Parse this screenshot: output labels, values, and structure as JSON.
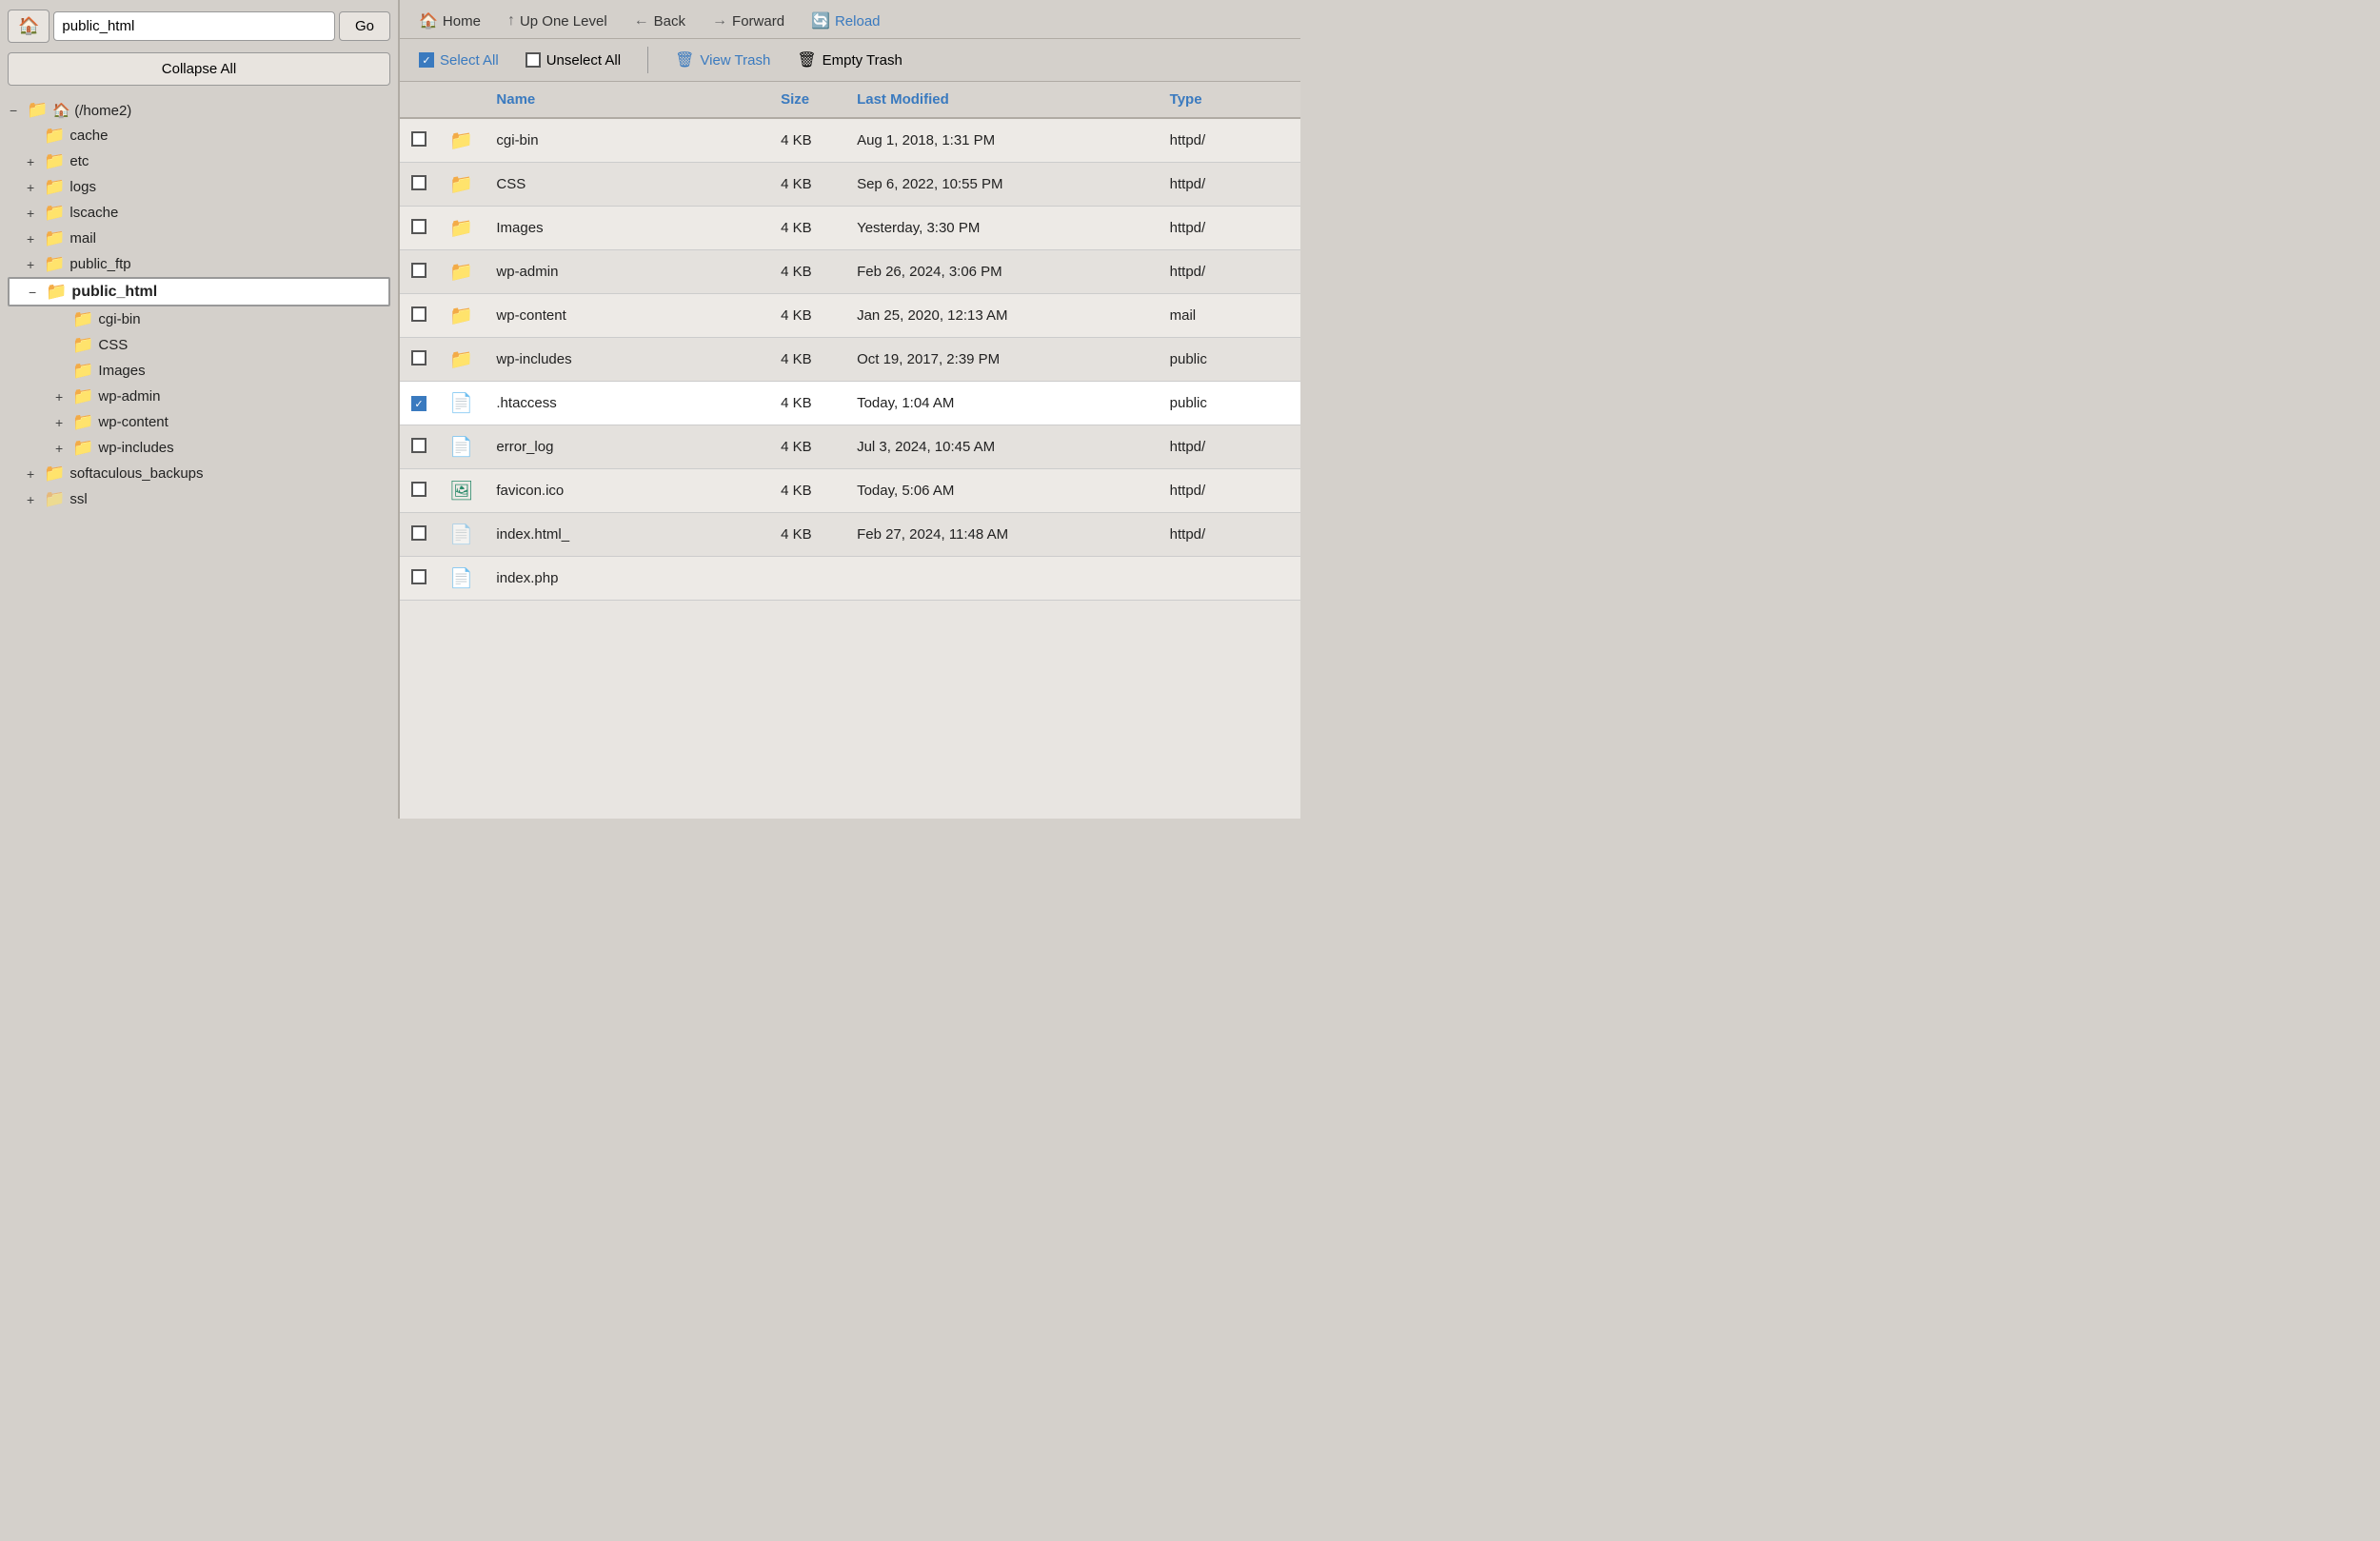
{
  "sidebar": {
    "path_value": "public_html",
    "go_label": "Go",
    "collapse_all_label": "Collapse All",
    "home_icon": "🏠",
    "tree": [
      {
        "id": "home2",
        "level": 0,
        "toggle": "−",
        "icon": "gold",
        "label": "(/home2)",
        "home": true
      },
      {
        "id": "cache",
        "level": 1,
        "toggle": "",
        "icon": "gold",
        "label": "cache"
      },
      {
        "id": "etc",
        "level": 1,
        "toggle": "+",
        "icon": "gold",
        "label": "etc"
      },
      {
        "id": "logs",
        "level": 1,
        "toggle": "+",
        "icon": "gold",
        "label": "logs"
      },
      {
        "id": "lscache",
        "level": 1,
        "toggle": "+",
        "icon": "gold",
        "label": "lscache"
      },
      {
        "id": "mail",
        "level": 1,
        "toggle": "+",
        "icon": "gold",
        "label": "mail"
      },
      {
        "id": "public_ftp",
        "level": 1,
        "toggle": "+",
        "icon": "gold",
        "label": "public_ftp"
      },
      {
        "id": "public_html",
        "level": 1,
        "toggle": "−",
        "icon": "gold",
        "label": "public_html",
        "selected": true
      },
      {
        "id": "cgi-bin-sub",
        "level": 2,
        "toggle": "",
        "icon": "gold",
        "label": "cgi-bin"
      },
      {
        "id": "css-sub",
        "level": 2,
        "toggle": "",
        "icon": "gold",
        "label": "CSS"
      },
      {
        "id": "images-sub",
        "level": 2,
        "toggle": "",
        "icon": "gold",
        "label": "Images"
      },
      {
        "id": "wp-admin-sub",
        "level": 2,
        "toggle": "+",
        "icon": "gold",
        "label": "wp-admin"
      },
      {
        "id": "wp-content-sub",
        "level": 2,
        "toggle": "+",
        "icon": "gold",
        "label": "wp-content"
      },
      {
        "id": "wp-includes-sub",
        "level": 2,
        "toggle": "+",
        "icon": "gold",
        "label": "wp-includes"
      },
      {
        "id": "softaculous",
        "level": 1,
        "toggle": "+",
        "icon": "gold",
        "label": "softaculous_backups"
      },
      {
        "id": "ssl",
        "level": 1,
        "toggle": "+",
        "icon": "light",
        "label": "ssl"
      }
    ]
  },
  "toolbar": {
    "home_label": "Home",
    "up_label": "Up One Level",
    "back_label": "Back",
    "forward_label": "Forward",
    "reload_label": "Reload"
  },
  "actions": {
    "select_all_label": "Select All",
    "unselect_all_label": "Unselect All",
    "view_trash_label": "View Trash",
    "empty_trash_label": "Empty Trash"
  },
  "table": {
    "columns": [
      "Name",
      "Size",
      "Last Modified",
      "Type"
    ],
    "rows": [
      {
        "id": 1,
        "name": "cgi-bin",
        "size": "4 KB",
        "modified": "Aug 1, 2018, 1:31 PM",
        "type": "httpd/",
        "icon": "folder",
        "selected": false
      },
      {
        "id": 2,
        "name": "CSS",
        "size": "4 KB",
        "modified": "Sep 6, 2022, 10:55 PM",
        "type": "httpd/",
        "icon": "folder",
        "selected": false
      },
      {
        "id": 3,
        "name": "Images",
        "size": "4 KB",
        "modified": "Yesterday, 3:30 PM",
        "type": "httpd/",
        "icon": "folder",
        "selected": false
      },
      {
        "id": 4,
        "name": "wp-admin",
        "size": "4 KB",
        "modified": "Feb 26, 2024, 3:06 PM",
        "type": "httpd/",
        "icon": "folder",
        "selected": false
      },
      {
        "id": 5,
        "name": "wp-content",
        "size": "4 KB",
        "modified": "Jan 25, 2020, 12:13 AM",
        "type": "mail",
        "icon": "folder",
        "selected": false
      },
      {
        "id": 6,
        "name": "wp-includes",
        "size": "4 KB",
        "modified": "Oct 19, 2017, 2:39 PM",
        "type": "public",
        "icon": "folder",
        "selected": false
      },
      {
        "id": 7,
        "name": ".htaccess",
        "size": "4 KB",
        "modified": "Today, 1:04 AM",
        "type": "public",
        "icon": "doc",
        "selected": true
      },
      {
        "id": 8,
        "name": "error_log",
        "size": "4 KB",
        "modified": "Jul 3, 2024, 10:45 AM",
        "type": "httpd/",
        "icon": "doc-dark",
        "selected": false
      },
      {
        "id": 9,
        "name": "favicon.ico",
        "size": "4 KB",
        "modified": "Today, 5:06 AM",
        "type": "httpd/",
        "icon": "img",
        "selected": false
      },
      {
        "id": 10,
        "name": "index.html_",
        "size": "4 KB",
        "modified": "Feb 27, 2024, 11:48 AM",
        "type": "httpd/",
        "icon": "faded",
        "selected": false
      },
      {
        "id": 11,
        "name": "index.php",
        "size": "",
        "modified": "",
        "type": "",
        "icon": "doc",
        "selected": false
      }
    ]
  }
}
